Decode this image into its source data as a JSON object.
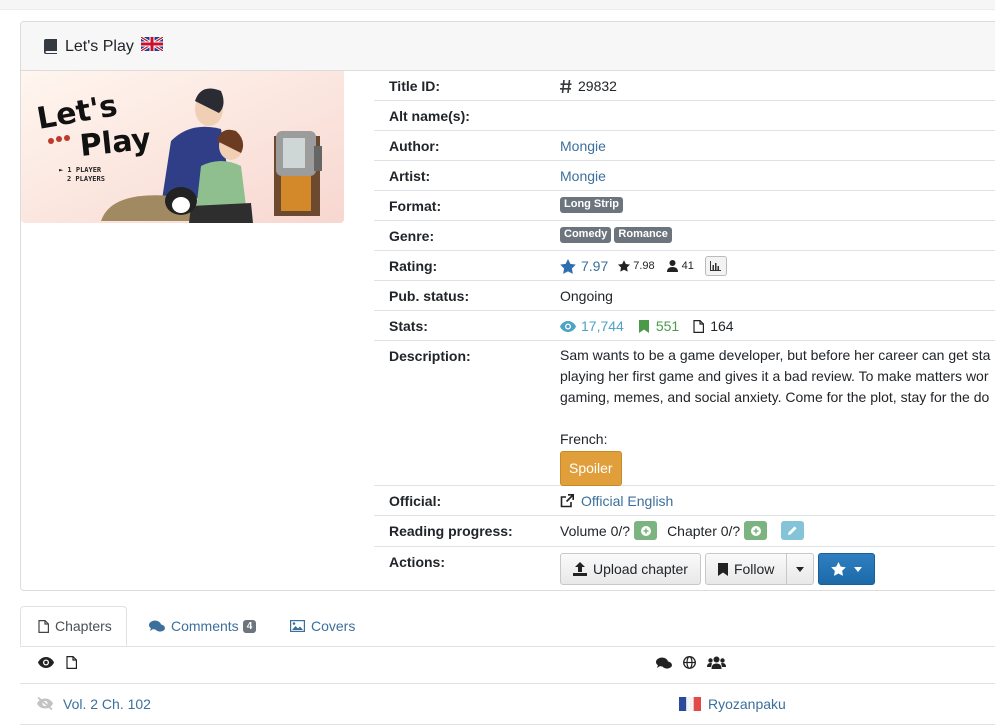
{
  "title": {
    "text": "Let's Play",
    "flag": "gb-flag"
  },
  "cover": {
    "logo_line1": "Let's",
    "logo_line2": "Play",
    "opt1": "► 1 PLAYER",
    "opt2": "2 PLAYERS"
  },
  "info": {
    "title_id": {
      "label": "Title ID:",
      "value": "29832"
    },
    "alt_names": {
      "label": "Alt name(s):",
      "value": ""
    },
    "author": {
      "label": "Author:",
      "value": "Mongie"
    },
    "artist": {
      "label": "Artist:",
      "value": "Mongie"
    },
    "format": {
      "label": "Format:",
      "badges": [
        "Long Strip"
      ]
    },
    "genre": {
      "label": "Genre:",
      "badges": [
        "Comedy",
        "Romance"
      ]
    },
    "rating": {
      "label": "Rating:",
      "bayesian": "7.97",
      "mean": "7.98",
      "users": "41"
    },
    "pub_status": {
      "label": "Pub. status:",
      "value": "Ongoing"
    },
    "stats": {
      "label": "Stats:",
      "views": "17,744",
      "follows": "551",
      "comments": "164"
    },
    "description": {
      "label": "Description:",
      "line1": "Sam wants to be a game developer, but before her career can get sta",
      "line2": "playing her first game and gives it a bad review. To make matters wor",
      "line3": "gaming, memes, and social anxiety. Come for the plot, stay for the do",
      "french_label": "French:",
      "spoiler_label": "Spoiler"
    },
    "official": {
      "label": "Official:",
      "value": "Official English"
    },
    "reading_progress": {
      "label": "Reading progress:",
      "volume": "Volume 0/?",
      "chapter": "Chapter 0/?"
    },
    "actions": {
      "label": "Actions:",
      "upload": "Upload chapter",
      "follow": "Follow"
    }
  },
  "tabs": [
    {
      "label": "Chapters",
      "active": true
    },
    {
      "label": "Comments",
      "count": "4"
    },
    {
      "label": "Covers"
    }
  ],
  "chapters": [
    {
      "title": "Vol. 2 Ch. 102",
      "group": "Ryozanpaku",
      "lang_flag": "fr-flag"
    }
  ],
  "colors": {
    "link": "#3c6f9c",
    "views": "#4da3c2",
    "follows": "#4a9a4a",
    "spoiler": "#e09f3a",
    "primary": "#1c6aa8"
  }
}
